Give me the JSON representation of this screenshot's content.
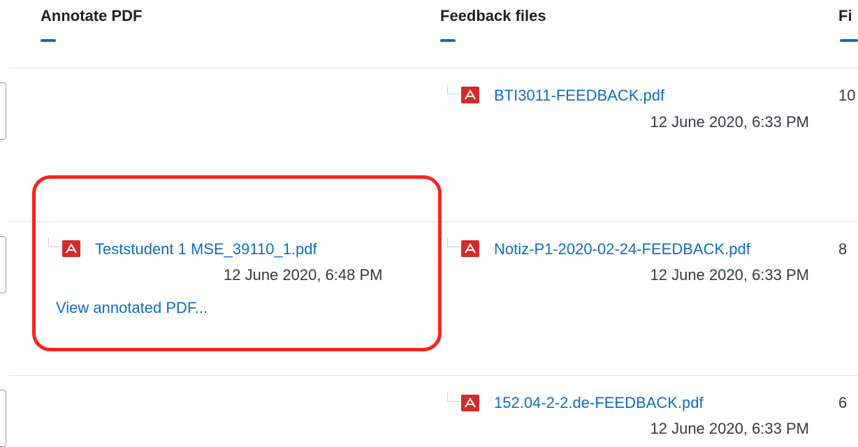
{
  "headers": {
    "annotate_pdf": "Annotate PDF",
    "feedback_files": "Feedback files",
    "next_column_partial": "Fi"
  },
  "rows": [
    {
      "feedback_file": {
        "name": "BTI3011-FEEDBACK.pdf",
        "date": "12 June 2020, 6:33 PM"
      },
      "next_column_partial": "10"
    },
    {
      "annotate_file": {
        "name": "Teststudent 1 MSE_39110_1.pdf",
        "date": "12 June 2020, 6:48 PM"
      },
      "view_annotated_link": "View annotated PDF...",
      "feedback_file": {
        "name": "Notiz-P1-2020-02-24-FEEDBACK.pdf",
        "date": "12 June 2020, 6:33 PM"
      },
      "next_column_partial": "8"
    },
    {
      "feedback_file": {
        "name": "152.04-2-2.de-FEEDBACK.pdf",
        "date": "12 June 2020, 6:33 PM"
      },
      "next_column_partial": "6"
    }
  ],
  "icons": {
    "pdf": "pdf-file-icon",
    "tree": "tree-connector-icon"
  },
  "colors": {
    "link": "#0f6cbf",
    "highlight": "#f3271c",
    "pdf_icon": "#d32b2b"
  }
}
